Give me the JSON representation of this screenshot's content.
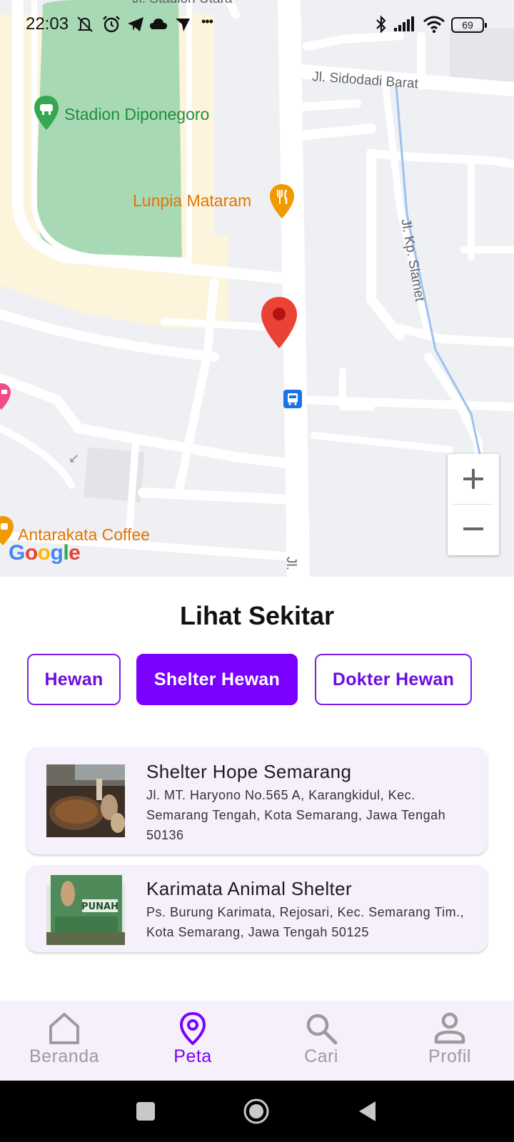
{
  "status_bar": {
    "time": "22:03",
    "battery": "69",
    "overflow_glyph": "•••"
  },
  "map": {
    "labels": {
      "stadium_top": "Jl. Stadion Utara",
      "street_sidodadi": "Jl. Sidodadi Barat",
      "park": "Stadion Diponegoro",
      "restaurant": "Lunpia Mataram",
      "street_slamet": "Jl. Kp. Slamet",
      "cafe": "Antarakata Coffee",
      "street_bottom": "Jl."
    },
    "google_logo": [
      "G",
      "o",
      "o",
      "g",
      "l",
      "e"
    ],
    "google_colors": [
      "#4285F4",
      "#EA4335",
      "#FBBC05",
      "#4285F4",
      "#34A853",
      "#EA4335"
    ],
    "zoom_in": "zoom-in-icon",
    "zoom_out": "zoom-out-icon"
  },
  "sheet": {
    "title": "Lihat Sekitar",
    "chips": [
      {
        "label": "Hewan",
        "active": false
      },
      {
        "label": "Shelter Hewan",
        "active": true
      },
      {
        "label": "Dokter Hewan",
        "active": false
      }
    ],
    "places": [
      {
        "name": "Shelter Hope Semarang",
        "address": "Jl. MT. Haryono No.565 A, Karangkidul, Kec. Semarang Tengah, Kota Semarang, Jawa Tengah 50136"
      },
      {
        "name": "Karimata Animal Shelter",
        "address": "Ps. Burung Karimata, Rejosari, Kec. Semarang Tim., Kota Semarang, Jawa Tengah 50125",
        "sign_text": "PUNAH"
      }
    ]
  },
  "bottom_nav": {
    "items": [
      {
        "label": "Beranda",
        "icon": "home-icon",
        "active": false
      },
      {
        "label": "Peta",
        "icon": "map-pin-icon",
        "active": true
      },
      {
        "label": "Cari",
        "icon": "search-icon",
        "active": false
      },
      {
        "label": "Profil",
        "icon": "person-icon",
        "active": false
      }
    ]
  },
  "colors": {
    "primary": "#7a00ff",
    "card_bg": "#f5f0fb",
    "nav_bg": "#f6f0fb",
    "marker": "#ea4335"
  }
}
